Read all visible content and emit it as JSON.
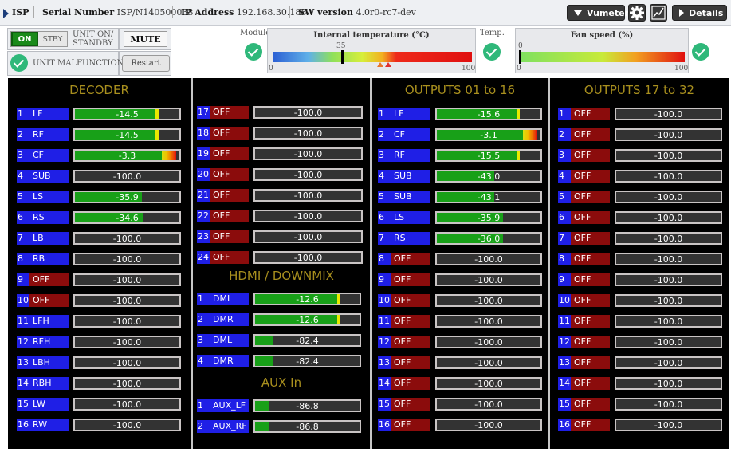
{
  "topbar": {
    "app": "ISP",
    "serial_label": "Serial Number",
    "serial_value": "ISP/N140500038",
    "ip_label": "IP Address",
    "ip_value": "192.168.30.188",
    "sw_label": "SW version",
    "sw_value": "4.0r0-rc7-dev",
    "vumeter_label": "Vumeter",
    "details_label": "Details"
  },
  "controls": {
    "on": "ON",
    "stby": "STBY",
    "unit_on_standby": [
      "UNIT ON/",
      "STANDBY"
    ],
    "mute": "MUTE",
    "malfunction": "UNIT MALFUNCTION",
    "restart": "Restart",
    "module_label": "Module",
    "temp_label": "Temp."
  },
  "temperature": {
    "title": "Internal temperature (°C)",
    "min": "0",
    "max": "100",
    "threshold": "35",
    "value": 57
  },
  "fan": {
    "title": "Fan speed (%)",
    "min": "0",
    "max": "100",
    "value": 0
  },
  "decoder": {
    "title": "DECODER",
    "rows": [
      {
        "num": "1",
        "name": "LF",
        "value": "-14.5",
        "level": 0.8,
        "on": true
      },
      {
        "num": "2",
        "name": "RF",
        "value": "-14.5",
        "level": 0.8,
        "on": true
      },
      {
        "num": "3",
        "name": "CF",
        "value": "-3.3",
        "level": 0.97,
        "on": true
      },
      {
        "num": "4",
        "name": "SUB",
        "value": "-100.0",
        "level": 0,
        "on": true
      },
      {
        "num": "5",
        "name": "LS",
        "value": "-35.9",
        "level": 0.64,
        "on": true
      },
      {
        "num": "6",
        "name": "RS",
        "value": "-34.6",
        "level": 0.66,
        "on": true
      },
      {
        "num": "7",
        "name": "LB",
        "value": "-100.0",
        "level": 0,
        "on": true
      },
      {
        "num": "8",
        "name": "RB",
        "value": "-100.0",
        "level": 0,
        "on": true
      },
      {
        "num": "9",
        "name": "OFF",
        "value": "-100.0",
        "level": 0,
        "on": false
      },
      {
        "num": "10",
        "name": "OFF",
        "value": "-100.0",
        "level": 0,
        "on": false
      },
      {
        "num": "11",
        "name": "LFH",
        "value": "-100.0",
        "level": 0,
        "on": true
      },
      {
        "num": "12",
        "name": "RFH",
        "value": "-100.0",
        "level": 0,
        "on": true
      },
      {
        "num": "13",
        "name": "LBH",
        "value": "-100.0",
        "level": 0,
        "on": true
      },
      {
        "num": "14",
        "name": "RBH",
        "value": "-100.0",
        "level": 0,
        "on": true
      },
      {
        "num": "15",
        "name": "LW",
        "value": "-100.0",
        "level": 0,
        "on": true
      },
      {
        "num": "16",
        "name": "RW",
        "value": "-100.0",
        "level": 0,
        "on": true
      }
    ]
  },
  "decoder2": {
    "rows": [
      {
        "num": "17",
        "name": "OFF",
        "value": "-100.0",
        "level": 0,
        "on": false
      },
      {
        "num": "18",
        "name": "OFF",
        "value": "-100.0",
        "level": 0,
        "on": false
      },
      {
        "num": "19",
        "name": "OFF",
        "value": "-100.0",
        "level": 0,
        "on": false
      },
      {
        "num": "20",
        "name": "OFF",
        "value": "-100.0",
        "level": 0,
        "on": false
      },
      {
        "num": "21",
        "name": "OFF",
        "value": "-100.0",
        "level": 0,
        "on": false
      },
      {
        "num": "22",
        "name": "OFF",
        "value": "-100.0",
        "level": 0,
        "on": false
      },
      {
        "num": "23",
        "name": "OFF",
        "value": "-100.0",
        "level": 0,
        "on": false
      },
      {
        "num": "24",
        "name": "OFF",
        "value": "-100.0",
        "level": 0,
        "on": false
      }
    ]
  },
  "hdmi": {
    "title": "HDMI / DOWNMIX",
    "rows": [
      {
        "num": "1",
        "name": "DML",
        "value": "-12.6",
        "level": 0.82,
        "on": true
      },
      {
        "num": "2",
        "name": "DMR",
        "value": "-12.6",
        "level": 0.82,
        "on": true
      },
      {
        "num": "3",
        "name": "DML",
        "value": "-82.4",
        "level": 0.17,
        "on": true
      },
      {
        "num": "4",
        "name": "DMR",
        "value": "-82.4",
        "level": 0.17,
        "on": true
      }
    ]
  },
  "aux": {
    "title": "AUX In",
    "rows": [
      {
        "num": "1",
        "name": "AUX_LF",
        "value": "-86.8",
        "level": 0.13,
        "on": true
      },
      {
        "num": "2",
        "name": "AUX_RF",
        "value": "-86.8",
        "level": 0.13,
        "on": true
      }
    ]
  },
  "outputs1": {
    "title": "OUTPUTS 01 to 16",
    "rows": [
      {
        "num": "1",
        "name": "LF",
        "value": "-15.6",
        "level": 0.8,
        "on": true
      },
      {
        "num": "2",
        "name": "CF",
        "value": "-3.1",
        "level": 0.97,
        "on": true
      },
      {
        "num": "3",
        "name": "RF",
        "value": "-15.5",
        "level": 0.8,
        "on": true
      },
      {
        "num": "4",
        "name": "SUB",
        "value": "-43.0",
        "level": 0.55,
        "on": true
      },
      {
        "num": "5",
        "name": "SUB",
        "value": "-43.1",
        "level": 0.55,
        "on": true
      },
      {
        "num": "6",
        "name": "LS",
        "value": "-35.9",
        "level": 0.64,
        "on": true
      },
      {
        "num": "7",
        "name": "RS",
        "value": "-36.0",
        "level": 0.64,
        "on": true
      },
      {
        "num": "8",
        "name": "OFF",
        "value": "-100.0",
        "level": 0,
        "on": false
      },
      {
        "num": "9",
        "name": "OFF",
        "value": "-100.0",
        "level": 0,
        "on": false
      },
      {
        "num": "10",
        "name": "OFF",
        "value": "-100.0",
        "level": 0,
        "on": false
      },
      {
        "num": "11",
        "name": "OFF",
        "value": "-100.0",
        "level": 0,
        "on": false
      },
      {
        "num": "12",
        "name": "OFF",
        "value": "-100.0",
        "level": 0,
        "on": false
      },
      {
        "num": "13",
        "name": "OFF",
        "value": "-100.0",
        "level": 0,
        "on": false
      },
      {
        "num": "14",
        "name": "OFF",
        "value": "-100.0",
        "level": 0,
        "on": false
      },
      {
        "num": "15",
        "name": "OFF",
        "value": "-100.0",
        "level": 0,
        "on": false
      },
      {
        "num": "16",
        "name": "OFF",
        "value": "-100.0",
        "level": 0,
        "on": false
      }
    ]
  },
  "outputs2": {
    "title": "OUTPUTS 17 to 32",
    "rows": [
      {
        "num": "1",
        "name": "OFF",
        "value": "-100.0",
        "level": 0,
        "on": false
      },
      {
        "num": "2",
        "name": "OFF",
        "value": "-100.0",
        "level": 0,
        "on": false
      },
      {
        "num": "3",
        "name": "OFF",
        "value": "-100.0",
        "level": 0,
        "on": false
      },
      {
        "num": "4",
        "name": "OFF",
        "value": "-100.0",
        "level": 0,
        "on": false
      },
      {
        "num": "5",
        "name": "OFF",
        "value": "-100.0",
        "level": 0,
        "on": false
      },
      {
        "num": "6",
        "name": "OFF",
        "value": "-100.0",
        "level": 0,
        "on": false
      },
      {
        "num": "7",
        "name": "OFF",
        "value": "-100.0",
        "level": 0,
        "on": false
      },
      {
        "num": "8",
        "name": "OFF",
        "value": "-100.0",
        "level": 0,
        "on": false
      },
      {
        "num": "9",
        "name": "OFF",
        "value": "-100.0",
        "level": 0,
        "on": false
      },
      {
        "num": "10",
        "name": "OFF",
        "value": "-100.0",
        "level": 0,
        "on": false
      },
      {
        "num": "11",
        "name": "OFF",
        "value": "-100.0",
        "level": 0,
        "on": false
      },
      {
        "num": "12",
        "name": "OFF",
        "value": "-100.0",
        "level": 0,
        "on": false
      },
      {
        "num": "13",
        "name": "OFF",
        "value": "-100.0",
        "level": 0,
        "on": false
      },
      {
        "num": "14",
        "name": "OFF",
        "value": "-100.0",
        "level": 0,
        "on": false
      },
      {
        "num": "15",
        "name": "OFF",
        "value": "-100.0",
        "level": 0,
        "on": false
      },
      {
        "num": "16",
        "name": "OFF",
        "value": "-100.0",
        "level": 0,
        "on": false
      }
    ]
  },
  "colors": {
    "on_bg": "#1f1fe6",
    "off_bg": "#8b0c0c",
    "meter_green": "#18a018",
    "section_title": "#a88f1e"
  }
}
